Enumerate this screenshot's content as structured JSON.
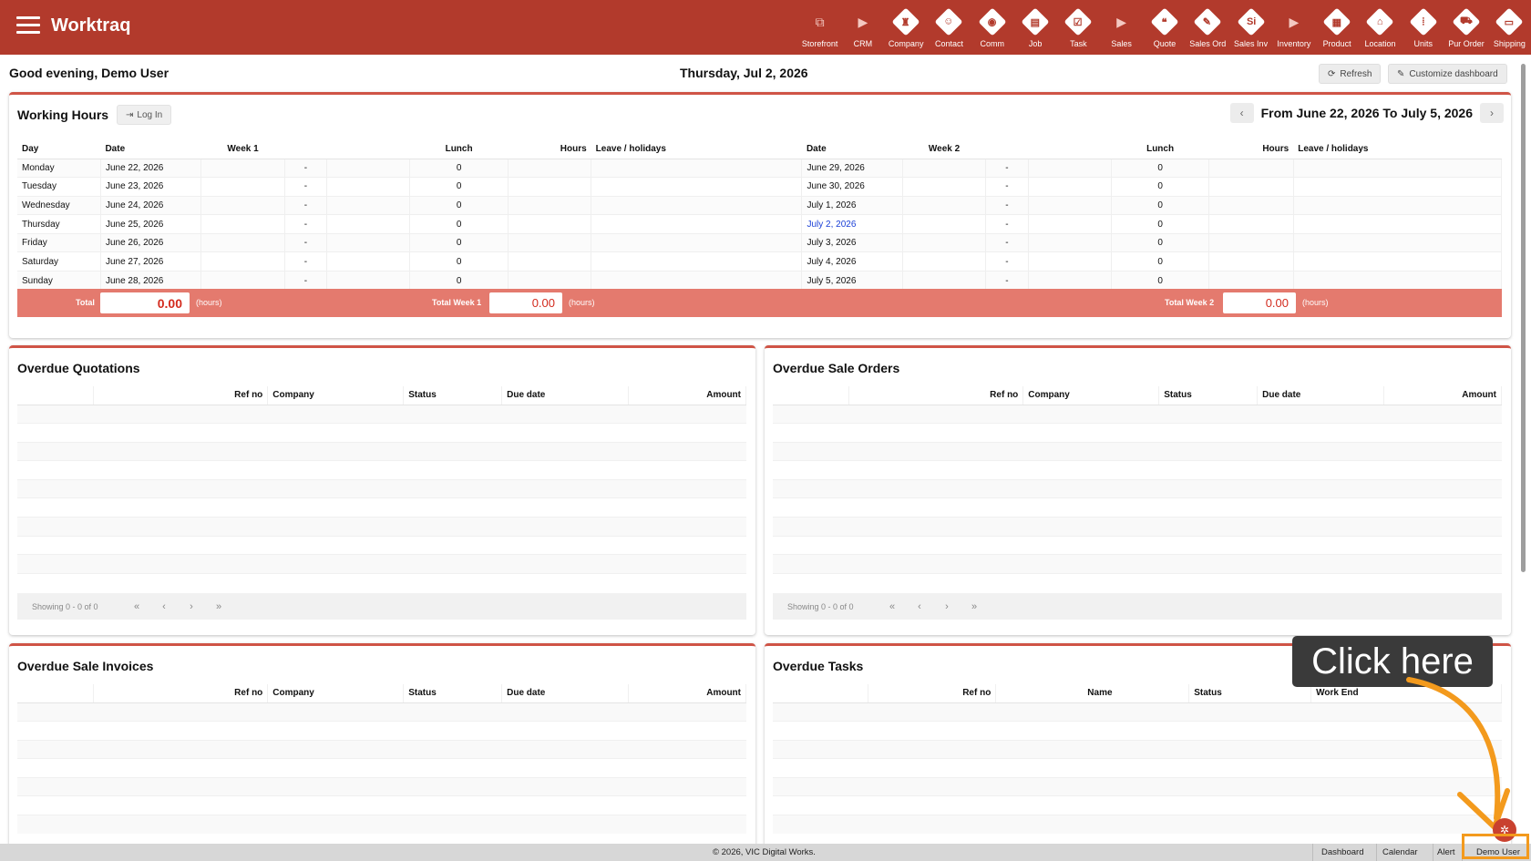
{
  "app": {
    "title": "Worktraq"
  },
  "nav": [
    {
      "label": "Storefront",
      "icon": "external-link-icon",
      "kind": "ext"
    },
    {
      "label": "CRM",
      "icon": "chevron-right-icon",
      "kind": "chev"
    },
    {
      "label": "Company",
      "icon": "company-icon",
      "kind": "diamond",
      "glyph": "♜"
    },
    {
      "label": "Contact",
      "icon": "contact-icon",
      "kind": "diamond",
      "glyph": "☺"
    },
    {
      "label": "Comm",
      "icon": "comm-icon",
      "kind": "diamond",
      "glyph": "◉"
    },
    {
      "label": "Job",
      "icon": "job-icon",
      "kind": "diamond",
      "glyph": "▤"
    },
    {
      "label": "Task",
      "icon": "task-icon",
      "kind": "diamond",
      "glyph": "☑"
    },
    {
      "label": "Sales",
      "icon": "chevron-right-icon",
      "kind": "chev"
    },
    {
      "label": "Quote",
      "icon": "quote-icon",
      "kind": "diamond",
      "glyph": "❝"
    },
    {
      "label": "Sales Ord",
      "icon": "sales-order-icon",
      "kind": "diamond",
      "glyph": "✎"
    },
    {
      "label": "Sales Inv",
      "icon": "sales-invoice-icon",
      "kind": "diamond",
      "glyph": "Si"
    },
    {
      "label": "Inventory",
      "icon": "chevron-right-icon",
      "kind": "chev"
    },
    {
      "label": "Product",
      "icon": "product-icon",
      "kind": "diamond",
      "glyph": "▦"
    },
    {
      "label": "Location",
      "icon": "location-icon",
      "kind": "diamond",
      "glyph": "⌂"
    },
    {
      "label": "Units",
      "icon": "units-icon",
      "kind": "diamond",
      "glyph": "⦙"
    },
    {
      "label": "Pur Order",
      "icon": "purchase-order-icon",
      "kind": "diamond",
      "glyph": "⛟"
    },
    {
      "label": "Shipping",
      "icon": "shipping-icon",
      "kind": "diamond",
      "glyph": "▭"
    }
  ],
  "header": {
    "greeting": "Good evening, Demo User",
    "date": "Thursday, Jul 2, 2026",
    "refresh_label": "Refresh",
    "customize_label": "Customize dashboard"
  },
  "working_hours": {
    "title": "Working Hours",
    "login_label": "Log In",
    "range_label": "From June 22, 2026 To July 5, 2026",
    "columns": {
      "day": "Day",
      "date": "Date",
      "week1": "Week 1",
      "lunch": "Lunch",
      "hours": "Hours",
      "leave": "Leave / holidays",
      "week2": "Week 2"
    },
    "rows": [
      {
        "day": "Monday",
        "date1": "June 22, 2026",
        "dash1": "-",
        "lunch1": "0",
        "date2": "June 29, 2026",
        "dash2": "-",
        "lunch2": "0"
      },
      {
        "day": "Tuesday",
        "date1": "June 23, 2026",
        "dash1": "-",
        "lunch1": "0",
        "date2": "June 30, 2026",
        "dash2": "-",
        "lunch2": "0"
      },
      {
        "day": "Wednesday",
        "date1": "June 24, 2026",
        "dash1": "-",
        "lunch1": "0",
        "date2": "July 1, 2026",
        "dash2": "-",
        "lunch2": "0"
      },
      {
        "day": "Thursday",
        "date1": "June 25, 2026",
        "dash1": "-",
        "lunch1": "0",
        "date2": "July 2, 2026",
        "dash2": "-",
        "lunch2": "0",
        "today": true
      },
      {
        "day": "Friday",
        "date1": "June 26, 2026",
        "dash1": "-",
        "lunch1": "0",
        "date2": "July 3, 2026",
        "dash2": "-",
        "lunch2": "0"
      },
      {
        "day": "Saturday",
        "date1": "June 27, 2026",
        "dash1": "-",
        "lunch1": "0",
        "date2": "July 4, 2026",
        "dash2": "-",
        "lunch2": "0"
      },
      {
        "day": "Sunday",
        "date1": "June 28, 2026",
        "dash1": "-",
        "lunch1": "0",
        "date2": "July 5, 2026",
        "dash2": "-",
        "lunch2": "0"
      }
    ],
    "totals": {
      "total_label": "Total",
      "total_value": "0.00",
      "week1_label": "Total Week 1",
      "week1_value": "0.00",
      "week2_label": "Total Week 2",
      "week2_value": "0.00",
      "unit": "(hours)"
    }
  },
  "overdue_quotations": {
    "title": "Overdue Quotations",
    "columns": [
      "",
      "Ref no",
      "Company",
      "Status",
      "Due date",
      "Amount"
    ],
    "pager": "Showing 0 - 0 of 0"
  },
  "overdue_sale_orders": {
    "title": "Overdue Sale Orders",
    "columns": [
      "",
      "Ref no",
      "Company",
      "Status",
      "Due date",
      "Amount"
    ],
    "pager": "Showing 0 - 0 of 0"
  },
  "overdue_sale_invoices": {
    "title": "Overdue Sale Invoices",
    "columns": [
      "",
      "Ref no",
      "Company",
      "Status",
      "Due date",
      "Amount"
    ]
  },
  "overdue_tasks": {
    "title": "Overdue Tasks",
    "columns": [
      "",
      "Ref no",
      "Name",
      "Status",
      "Work End"
    ]
  },
  "footer": {
    "copyright": "© 2026, VIC Digital Works.",
    "links": [
      "Dashboard",
      "Calendar",
      "Alert",
      "Demo User"
    ]
  },
  "overlay": {
    "tooltip": "Click here"
  },
  "colors": {
    "brand": "#b23a2c",
    "accent_border": "#cf5446",
    "totals_bar": "#e47a6e",
    "highlight": "#f39a1d"
  }
}
